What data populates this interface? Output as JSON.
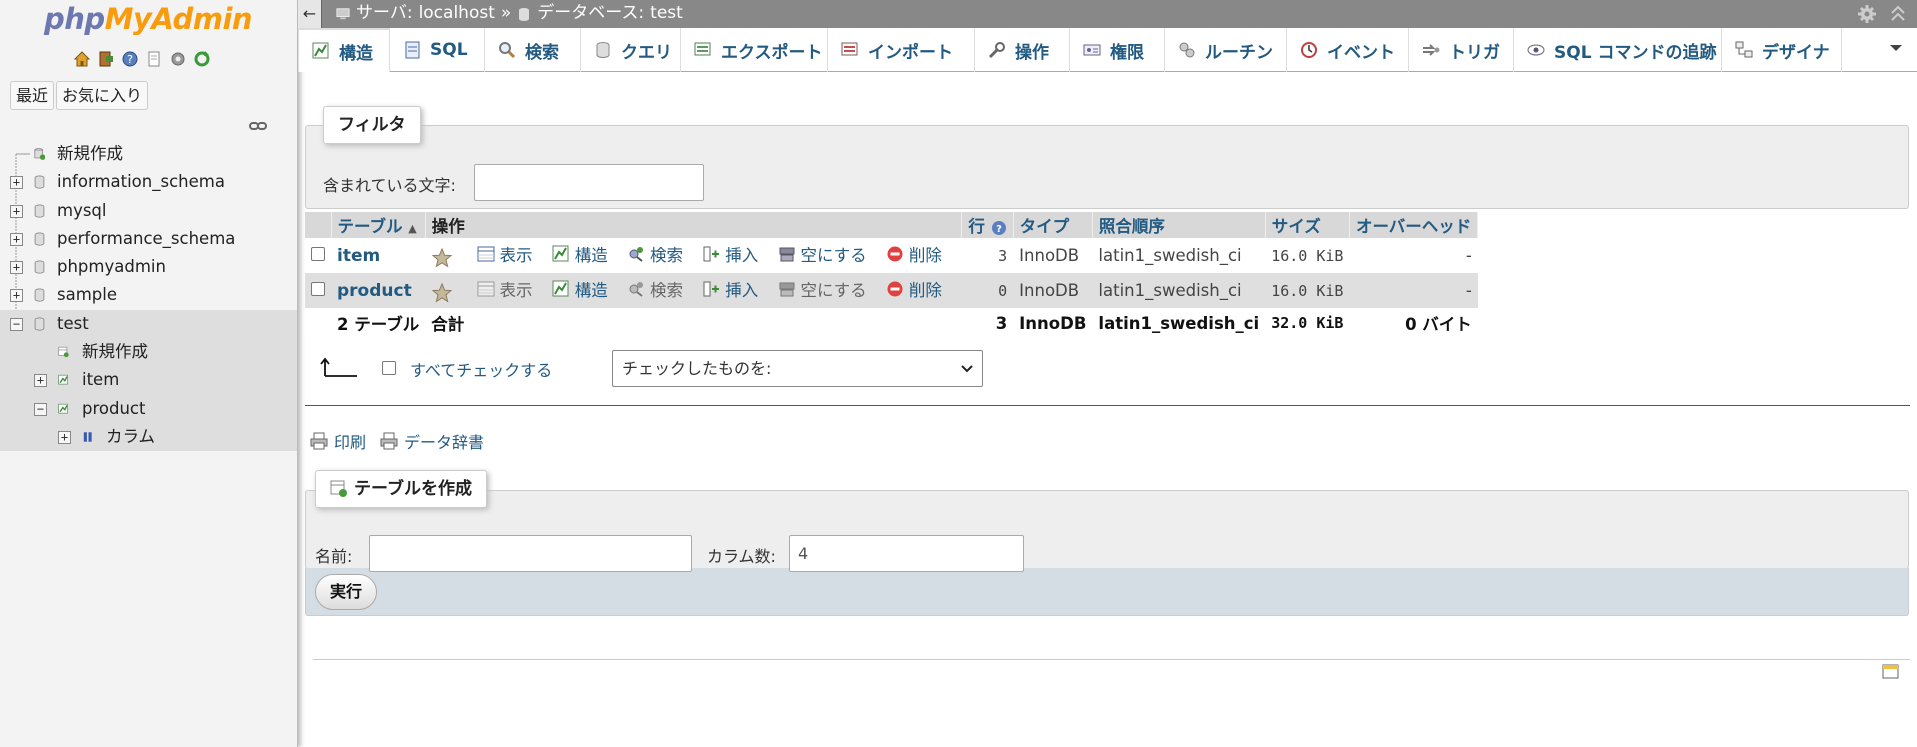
{
  "logo": {
    "php": "php",
    "myadmin": "MyAdmin"
  },
  "nav": {
    "tabs": [
      "最近",
      "お気に入り"
    ],
    "tree": [
      {
        "label": "新規作成",
        "level": 0,
        "expander": "",
        "icon": "new-db-icon"
      },
      {
        "label": "information_schema",
        "level": 0,
        "expander": "+",
        "icon": "database-icon"
      },
      {
        "label": "mysql",
        "level": 0,
        "expander": "+",
        "icon": "database-icon"
      },
      {
        "label": "performance_schema",
        "level": 0,
        "expander": "+",
        "icon": "database-icon"
      },
      {
        "label": "phpmyadmin",
        "level": 0,
        "expander": "+",
        "icon": "database-icon"
      },
      {
        "label": "sample",
        "level": 0,
        "expander": "+",
        "icon": "database-icon"
      },
      {
        "label": "test",
        "level": 0,
        "expander": "−",
        "icon": "database-icon",
        "selected": true
      },
      {
        "label": "新規作成",
        "level": 1,
        "expander": "",
        "icon": "new-table-icon",
        "selected": true
      },
      {
        "label": "item",
        "level": 1,
        "expander": "+",
        "icon": "table-icon",
        "selected": true
      },
      {
        "label": "product",
        "level": 1,
        "expander": "−",
        "icon": "table-icon",
        "selected": true
      },
      {
        "label": "カラム",
        "level": 2,
        "expander": "+",
        "icon": "columns-icon",
        "selected": true
      }
    ]
  },
  "topbar": {
    "server_label": "サーバ:",
    "server": "localhost",
    "separator": "»",
    "db_label": "データベース:",
    "db": "test",
    "collapse": "←"
  },
  "menu": {
    "tabs": [
      {
        "label": "構造",
        "icon": "structure-icon"
      },
      {
        "label": "SQL",
        "icon": "sql-icon"
      },
      {
        "label": "検索",
        "icon": "search-icon"
      },
      {
        "label": "クエリ",
        "icon": "query-icon"
      },
      {
        "label": "エクスポート",
        "icon": "export-icon"
      },
      {
        "label": "インポート",
        "icon": "import-icon"
      },
      {
        "label": "操作",
        "icon": "operations-icon"
      },
      {
        "label": "権限",
        "icon": "privileges-icon"
      },
      {
        "label": "ルーチン",
        "icon": "routines-icon"
      },
      {
        "label": "イベント",
        "icon": "events-icon"
      },
      {
        "label": "トリガ",
        "icon": "triggers-icon"
      },
      {
        "label": "SQL コマンドの追跡",
        "icon": "tracking-icon"
      },
      {
        "label": "デザイナ",
        "icon": "designer-icon"
      }
    ]
  },
  "filter": {
    "legend": "フィルタ",
    "label": "含まれている文字:",
    "value": ""
  },
  "table": {
    "headers": {
      "table": "テーブル",
      "action": "操作",
      "rows": "行",
      "type": "タイプ",
      "collation": "照合順序",
      "size": "サイズ",
      "overhead": "オーバーヘッド"
    },
    "actions": {
      "browse": "表示",
      "structure": "構造",
      "search": "検索",
      "insert": "挿入",
      "empty": "空にする",
      "drop": "削除"
    },
    "rows": [
      {
        "name": "item",
        "rows": "3",
        "type": "InnoDB",
        "collation": "latin1_swedish_ci",
        "size": "16.0 KiB",
        "overhead": "-"
      },
      {
        "name": "product",
        "rows": "0",
        "type": "InnoDB",
        "collation": "latin1_swedish_ci",
        "size": "16.0 KiB",
        "overhead": "-"
      }
    ],
    "total": {
      "name": "2 テーブル",
      "label": "合計",
      "rows": "3",
      "type": "InnoDB",
      "collation": "latin1_swedish_ci",
      "size": "32.0 KiB",
      "overhead": "0 バイト"
    }
  },
  "bulk": {
    "check_all": "すべてチェックする",
    "with_selected": "チェックしたものを:"
  },
  "tools": {
    "print": "印刷",
    "dictionary": "データ辞書"
  },
  "create": {
    "legend": "テーブルを作成",
    "name_label": "名前:",
    "name_value": "",
    "cols_label": "カラム数:",
    "cols_value": "4",
    "submit": "実行"
  },
  "colors": {
    "link": "#235a81",
    "topbar": "#888888",
    "accent_orange": "#f89c0e",
    "logo_blue": "#6c78af"
  }
}
